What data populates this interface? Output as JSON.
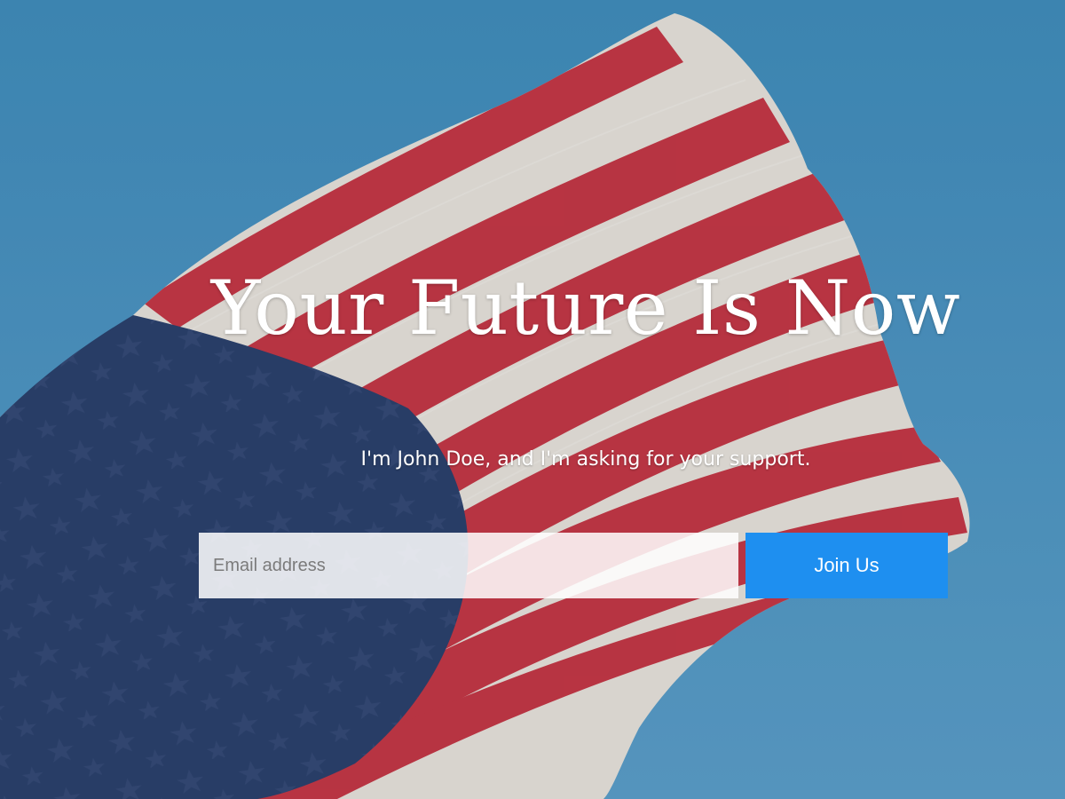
{
  "hero": {
    "headline": "Your Future Is Now",
    "subheadline": "I'm John Doe, and I'm asking for your support.",
    "background_image": "american-flag-waving-against-blue-sky"
  },
  "signup": {
    "email_placeholder": "Email address",
    "email_value": "",
    "join_label": "Join Us"
  },
  "colors": {
    "sky": "#4d93bf",
    "flag_red": "#c8283a",
    "flag_white": "#ece4dc",
    "flag_blue": "#2b3f6c",
    "button_blue": "#1e8ff0"
  }
}
